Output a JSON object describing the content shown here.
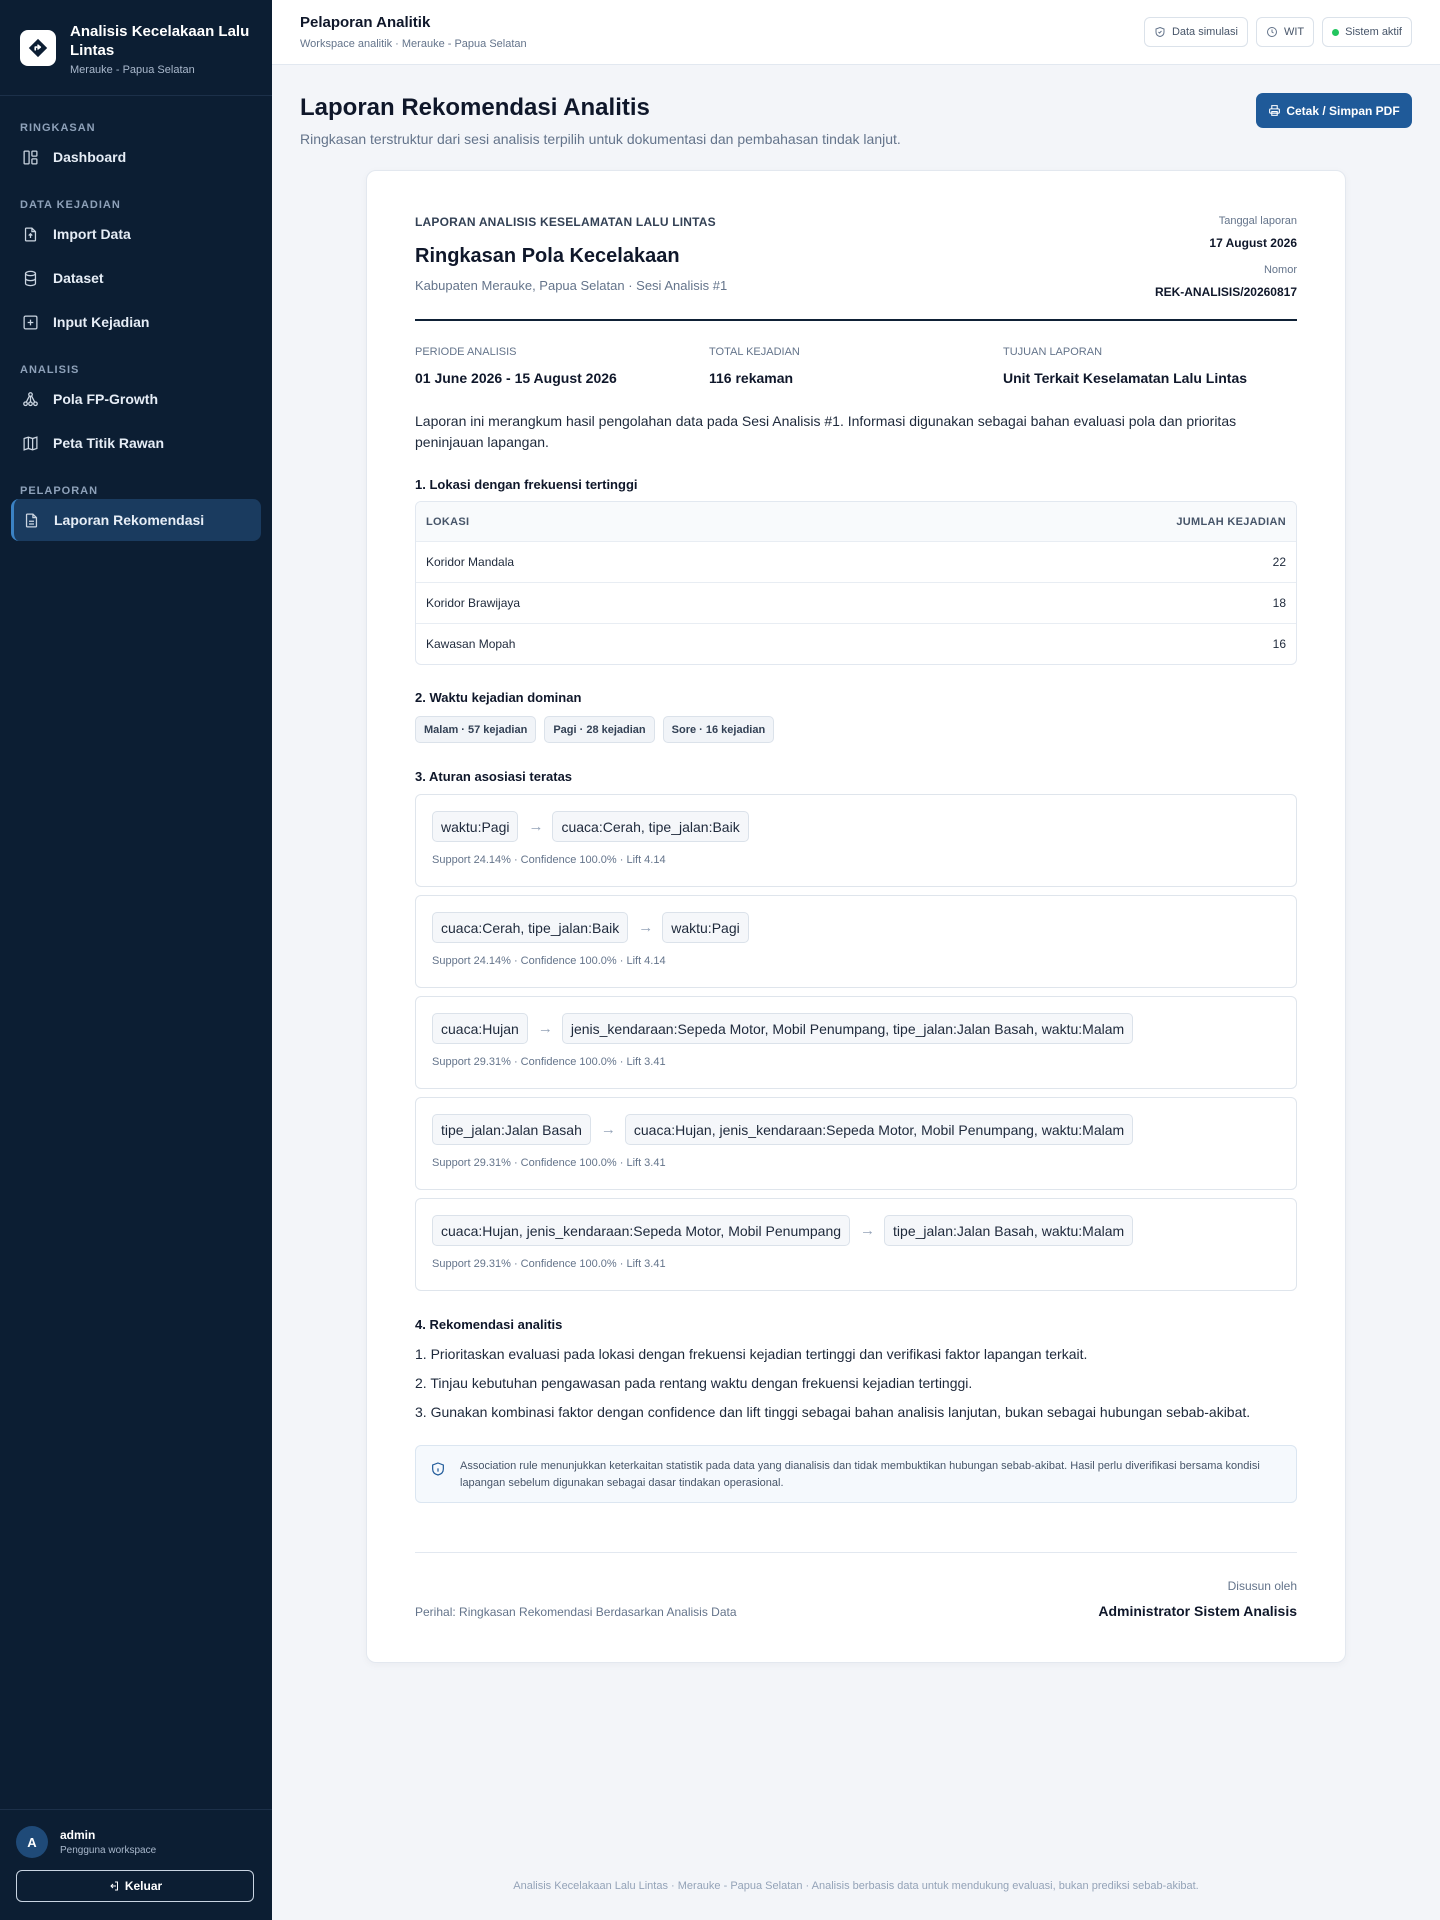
{
  "brand": {
    "title": "Analisis Kecelakaan Lalu Lintas",
    "subtitle": "Merauke - Papua Selatan"
  },
  "sidebar": {
    "sections": [
      {
        "label": "RINGKASAN",
        "items": [
          {
            "label": "Dashboard",
            "icon": "dashboard-icon"
          }
        ]
      },
      {
        "label": "DATA KEJADIAN",
        "items": [
          {
            "label": "Import Data",
            "icon": "file-upload-icon"
          },
          {
            "label": "Dataset",
            "icon": "database-icon"
          },
          {
            "label": "Input Kejadian",
            "icon": "plus-square-icon"
          }
        ]
      },
      {
        "label": "ANALISIS",
        "items": [
          {
            "label": "Pola FP-Growth",
            "icon": "network-icon"
          },
          {
            "label": "Peta Titik Rawan",
            "icon": "map-icon"
          }
        ]
      },
      {
        "label": "PELAPORAN",
        "items": [
          {
            "label": "Laporan Rekomendasi",
            "icon": "document-icon",
            "active": true
          }
        ]
      }
    ]
  },
  "user": {
    "initial": "A",
    "name": "admin",
    "role": "Pengguna workspace",
    "logout_label": "Keluar"
  },
  "topbar": {
    "title": "Pelaporan Analitik",
    "breadcrumb": "Workspace analitik · Merauke - Papua Selatan",
    "badges": {
      "simulasi": "Data simulasi",
      "timezone": "WIT",
      "status": "Sistem aktif"
    }
  },
  "page": {
    "title": "Laporan Rekomendasi Analitis",
    "subtitle": "Ringkasan terstruktur dari sesi analisis terpilih untuk dokumentasi dan pembahasan tindak lanjut.",
    "print_label": "Cetak / Simpan PDF"
  },
  "report": {
    "kicker": "LAPORAN ANALISIS KESELAMATAN LALU LINTAS",
    "title": "Ringkasan Pola Kecelakaan",
    "subtitle": "Kabupaten Merauke, Papua Selatan · Sesi Analisis #1",
    "date_label": "Tanggal laporan",
    "date_value": "17 August 2026",
    "number_label": "Nomor",
    "number_value": "REK-ANALISIS/20260817",
    "facts": {
      "period_label": "PERIODE ANALISIS",
      "period_value": "01 June 2026 - 15 August 2026",
      "total_label": "TOTAL KEJADIAN",
      "total_value": "116 rekaman",
      "purpose_label": "TUJUAN LAPORAN",
      "purpose_value": "Unit Terkait Keselamatan Lalu Lintas"
    },
    "intro": "Laporan ini merangkum hasil pengolahan data pada Sesi Analisis #1. Informasi digunakan sebagai bahan evaluasi pola dan prioritas peninjauan lapangan.",
    "section1": {
      "heading": "1. Lokasi dengan frekuensi tertinggi",
      "col_location": "LOKASI",
      "col_count": "JUMLAH KEJADIAN",
      "rows": [
        {
          "location": "Koridor Mandala",
          "count": "22"
        },
        {
          "location": "Koridor Brawijaya",
          "count": "18"
        },
        {
          "location": "Kawasan Mopah",
          "count": "16"
        }
      ]
    },
    "section2": {
      "heading": "2. Waktu kejadian dominan",
      "chips": [
        "Malam · 57 kejadian",
        "Pagi · 28 kejadian",
        "Sore · 16 kejadian"
      ]
    },
    "section3": {
      "heading": "3. Aturan asosiasi teratas",
      "rules": [
        {
          "antecedent": "waktu:Pagi",
          "consequent": "cuaca:Cerah, tipe_jalan:Baik",
          "stats": "Support 24.14% · Confidence 100.0% · Lift 4.14"
        },
        {
          "antecedent": "cuaca:Cerah, tipe_jalan:Baik",
          "consequent": "waktu:Pagi",
          "stats": "Support 24.14% · Confidence 100.0% · Lift 4.14"
        },
        {
          "antecedent": "cuaca:Hujan",
          "consequent": "jenis_kendaraan:Sepeda Motor, Mobil Penumpang, tipe_jalan:Jalan Basah, waktu:Malam",
          "stats": "Support 29.31% · Confidence 100.0% · Lift 3.41"
        },
        {
          "antecedent": "tipe_jalan:Jalan Basah",
          "consequent": "cuaca:Hujan, jenis_kendaraan:Sepeda Motor, Mobil Penumpang, waktu:Malam",
          "stats": "Support 29.31% · Confidence 100.0% · Lift 3.41"
        },
        {
          "antecedent": "cuaca:Hujan, jenis_kendaraan:Sepeda Motor, Mobil Penumpang",
          "consequent": "tipe_jalan:Jalan Basah, waktu:Malam",
          "stats": "Support 29.31% · Confidence 100.0% · Lift 3.41"
        }
      ]
    },
    "section4": {
      "heading": "4. Rekomendasi analitis",
      "items": [
        "1. Prioritaskan evaluasi pada lokasi dengan frekuensi kejadian tertinggi dan verifikasi faktor lapangan terkait.",
        "2. Tinjau kebutuhan pengawasan pada rentang waktu dengan frekuensi kejadian tertinggi.",
        "3. Gunakan kombinasi faktor dengan confidence dan lift tinggi sebagai bahan analisis lanjutan, bukan sebagai hubungan sebab-akibat."
      ]
    },
    "notice": "Association rule menunjukkan keterkaitan statistik pada data yang dianalisis dan tidak membuktikan hubungan sebab-akibat. Hasil perlu diverifikasi bersama kondisi lapangan sebelum digunakan sebagai dasar tindakan operasional.",
    "perihal": "Perihal: Ringkasan Rekomendasi Berdasarkan Analisis Data",
    "signer_label": "Disusun oleh",
    "signer_name": "Administrator Sistem Analisis"
  },
  "footer": "Analisis Kecelakaan Lalu Lintas · Merauke - Papua Selatan · Analisis berbasis data untuk mendukung evaluasi, bukan prediksi sebab-akibat.",
  "colors": {
    "sidebar_bg": "#0c1e33",
    "accent": "#1f5a99",
    "active_item": "#1a3b5f",
    "status_green": "#22c55e"
  }
}
